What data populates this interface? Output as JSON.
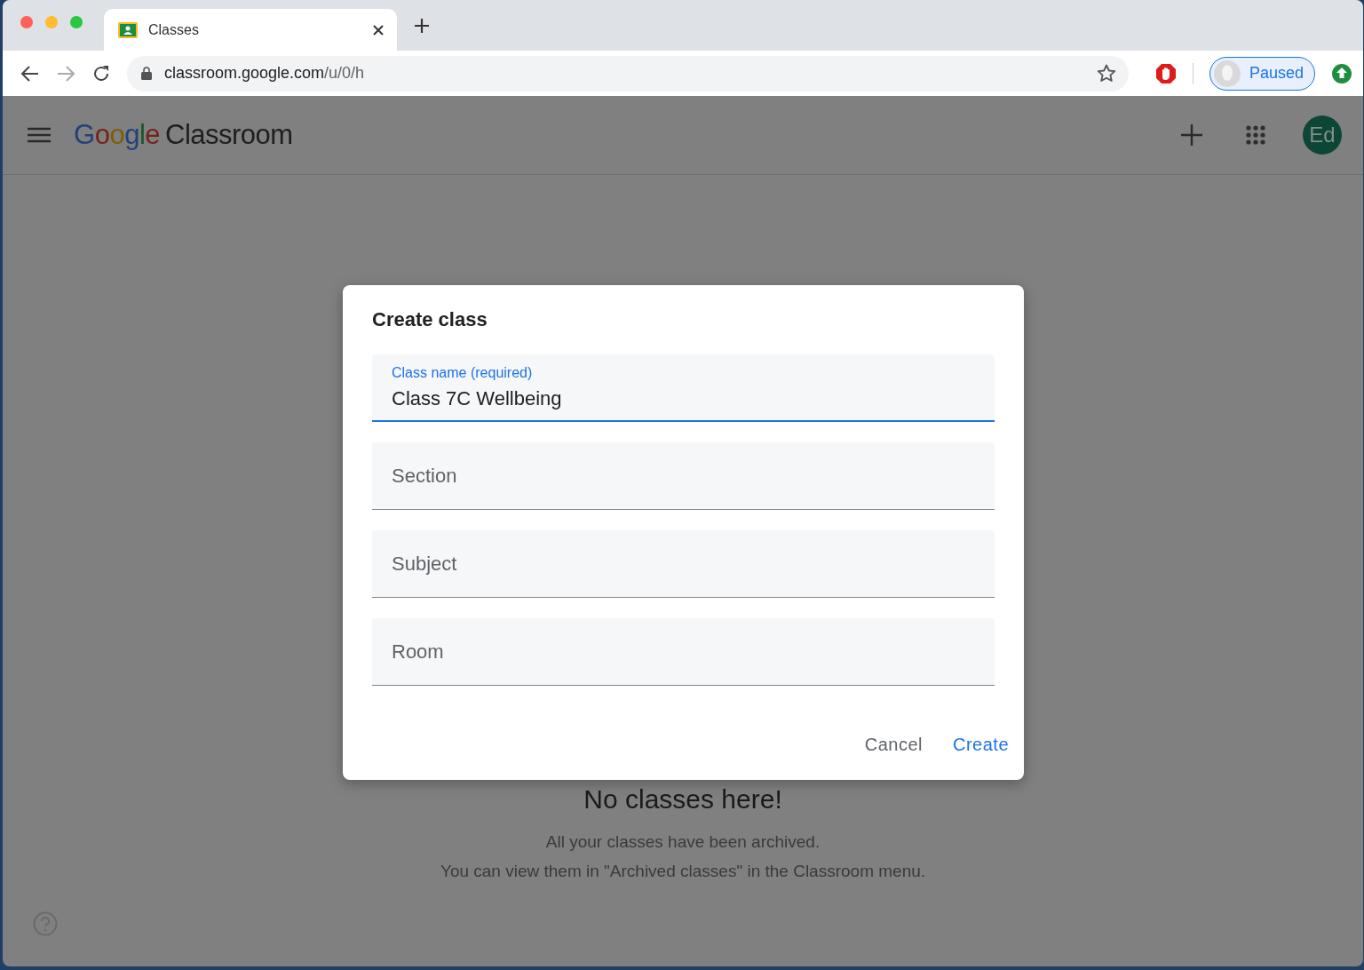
{
  "browser": {
    "tab": {
      "title": "Classes",
      "selected": true
    },
    "url": {
      "host": "classroom.google.com",
      "path": "/u/0/h"
    },
    "profile": {
      "label": "Paused"
    }
  },
  "app": {
    "brand": {
      "logo": "Google",
      "name": "Classroom"
    },
    "avatar": "Ed"
  },
  "empty_state": {
    "title": "No classes here!",
    "lines": [
      "All your classes have been archived.",
      "You can view them in \"Archived classes\" in the Classroom menu."
    ]
  },
  "dialog": {
    "title": "Create class",
    "fields": [
      {
        "label": "Class name (required)",
        "value": "Class 7C Wellbeing",
        "focused": true
      },
      {
        "placeholder": "Section",
        "focused": false
      },
      {
        "placeholder": "Subject",
        "focused": false
      },
      {
        "placeholder": "Room",
        "focused": false
      }
    ],
    "buttons": [
      {
        "label": "Cancel",
        "kind": "secondary"
      },
      {
        "label": "Create",
        "kind": "primary"
      }
    ]
  }
}
